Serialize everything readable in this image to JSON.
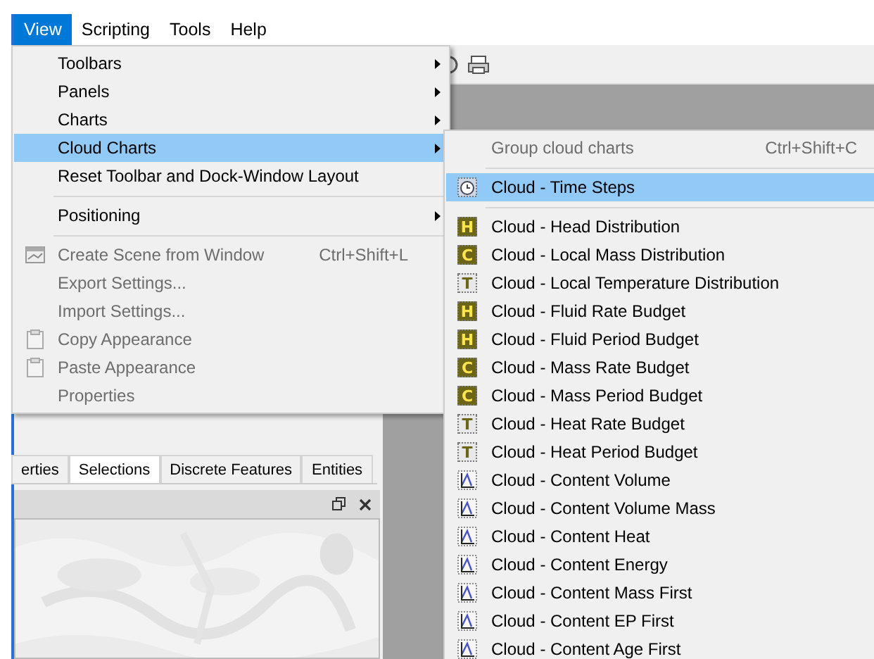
{
  "menubar": [
    {
      "label": "View",
      "selected": true
    },
    {
      "label": "Scripting",
      "selected": false
    },
    {
      "label": "Tools",
      "selected": false
    },
    {
      "label": "Help",
      "selected": false
    }
  ],
  "view_menu": {
    "items": [
      {
        "kind": "item",
        "label": "Toolbars",
        "submenu": true,
        "disabled": false,
        "selected": false
      },
      {
        "kind": "item",
        "label": "Panels",
        "submenu": true,
        "disabled": false,
        "selected": false
      },
      {
        "kind": "item",
        "label": "Charts",
        "submenu": true,
        "disabled": false,
        "selected": false
      },
      {
        "kind": "item",
        "label": "Cloud Charts",
        "submenu": true,
        "disabled": false,
        "selected": true
      },
      {
        "kind": "item",
        "label": "Reset Toolbar and Dock-Window Layout",
        "submenu": false,
        "disabled": false,
        "selected": false
      },
      {
        "kind": "separator"
      },
      {
        "kind": "item",
        "label": "Positioning",
        "submenu": true,
        "disabled": false,
        "selected": false
      },
      {
        "kind": "separator"
      },
      {
        "kind": "item",
        "label": "Create Scene from Window",
        "shortcut": "Ctrl+Shift+L",
        "icon": {
          "kind": "window"
        },
        "submenu": false,
        "disabled": true,
        "selected": false
      },
      {
        "kind": "item",
        "label": "Export Settings...",
        "submenu": false,
        "disabled": true,
        "selected": false
      },
      {
        "kind": "item",
        "label": "Import Settings...",
        "submenu": false,
        "disabled": true,
        "selected": false
      },
      {
        "kind": "item",
        "label": "Copy Appearance",
        "icon": {
          "kind": "clipboard"
        },
        "submenu": false,
        "disabled": true,
        "selected": false
      },
      {
        "kind": "item",
        "label": "Paste Appearance",
        "icon": {
          "kind": "clipboard"
        },
        "submenu": false,
        "disabled": true,
        "selected": false
      },
      {
        "kind": "item",
        "label": "Properties",
        "submenu": false,
        "disabled": true,
        "selected": false
      }
    ]
  },
  "cloud_charts_menu": {
    "items": [
      {
        "kind": "item",
        "label": "Group cloud charts",
        "shortcut": "Ctrl+Shift+C",
        "disabled": true,
        "selected": false
      },
      {
        "kind": "separator"
      },
      {
        "kind": "item",
        "label": "Cloud - Time Steps",
        "icon": {
          "kind": "clock"
        },
        "disabled": false,
        "selected": true
      },
      {
        "kind": "separator"
      },
      {
        "kind": "item",
        "label": "Cloud - Head Distribution",
        "icon": {
          "kind": "letter",
          "letter": "H"
        },
        "disabled": false,
        "selected": false
      },
      {
        "kind": "item",
        "label": "Cloud - Local Mass Distribution",
        "icon": {
          "kind": "letter",
          "letter": "C"
        },
        "disabled": false,
        "selected": false
      },
      {
        "kind": "item",
        "label": "Cloud - Local Temperature Distribution",
        "icon": {
          "kind": "letter",
          "letter": "T"
        },
        "disabled": false,
        "selected": false
      },
      {
        "kind": "item",
        "label": "Cloud - Fluid Rate Budget",
        "icon": {
          "kind": "letter",
          "letter": "H"
        },
        "disabled": false,
        "selected": false
      },
      {
        "kind": "item",
        "label": "Cloud - Fluid Period Budget",
        "icon": {
          "kind": "letter",
          "letter": "H"
        },
        "disabled": false,
        "selected": false
      },
      {
        "kind": "item",
        "label": "Cloud - Mass Rate Budget",
        "icon": {
          "kind": "letter",
          "letter": "C"
        },
        "disabled": false,
        "selected": false
      },
      {
        "kind": "item",
        "label": "Cloud - Mass Period Budget",
        "icon": {
          "kind": "letter",
          "letter": "C"
        },
        "disabled": false,
        "selected": false
      },
      {
        "kind": "item",
        "label": "Cloud - Heat Rate Budget",
        "icon": {
          "kind": "letter",
          "letter": "T"
        },
        "disabled": false,
        "selected": false
      },
      {
        "kind": "item",
        "label": "Cloud - Heat Period Budget",
        "icon": {
          "kind": "letter",
          "letter": "T"
        },
        "disabled": false,
        "selected": false
      },
      {
        "kind": "item",
        "label": "Cloud - Content Volume",
        "icon": {
          "kind": "chart"
        },
        "disabled": false,
        "selected": false
      },
      {
        "kind": "item",
        "label": "Cloud - Content Volume Mass",
        "icon": {
          "kind": "chart"
        },
        "disabled": false,
        "selected": false
      },
      {
        "kind": "item",
        "label": "Cloud - Content Heat",
        "icon": {
          "kind": "chart"
        },
        "disabled": false,
        "selected": false
      },
      {
        "kind": "item",
        "label": "Cloud - Content Energy",
        "icon": {
          "kind": "chart"
        },
        "disabled": false,
        "selected": false
      },
      {
        "kind": "item",
        "label": "Cloud - Content Mass First",
        "icon": {
          "kind": "chart"
        },
        "disabled": false,
        "selected": false
      },
      {
        "kind": "item",
        "label": "Cloud - Content EP First",
        "icon": {
          "kind": "chart"
        },
        "disabled": false,
        "selected": false
      },
      {
        "kind": "item",
        "label": "Cloud - Content Age First",
        "icon": {
          "kind": "chart"
        },
        "disabled": false,
        "selected": false
      }
    ]
  },
  "dock": {
    "tabs": [
      {
        "label": "erties",
        "selected": false
      },
      {
        "label": "Selections",
        "selected": true
      },
      {
        "label": "Discrete Features",
        "selected": false
      },
      {
        "label": "Entities",
        "selected": false
      }
    ]
  }
}
